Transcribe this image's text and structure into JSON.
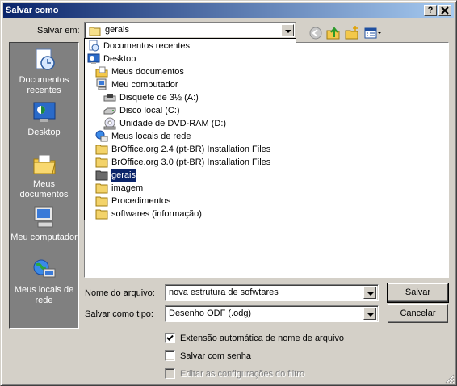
{
  "window": {
    "title": "Salvar como",
    "help_button": "?",
    "close_button": "✕"
  },
  "toolbar": {
    "save_in_label": "Salvar em:",
    "save_in_value": "gerais",
    "icons": [
      "back-icon",
      "up-folder-icon",
      "new-folder-icon",
      "view-menu-icon"
    ]
  },
  "places": [
    {
      "label": "Documentos recentes",
      "icon": "recent-documents-icon"
    },
    {
      "label": "Desktop",
      "icon": "desktop-icon"
    },
    {
      "label": "Meus documentos",
      "icon": "my-documents-icon"
    },
    {
      "label": "Meu computador",
      "icon": "my-computer-icon"
    },
    {
      "label": "Meus locais de rede",
      "icon": "network-places-icon"
    }
  ],
  "dropdown": {
    "items": [
      {
        "label": "Documentos recentes",
        "icon": "recent-documents-icon"
      },
      {
        "label": "Desktop",
        "icon": "desktop-icon"
      },
      {
        "label": "Meus documentos",
        "icon": "my-documents-icon"
      },
      {
        "label": "Meu computador",
        "icon": "my-computer-icon"
      },
      {
        "label": "Disquete de 3½ (A:)",
        "icon": "floppy-drive-icon"
      },
      {
        "label": "Disco local (C:)",
        "icon": "hard-drive-icon"
      },
      {
        "label": "Unidade de DVD-RAM (D:)",
        "icon": "dvd-drive-icon"
      },
      {
        "label": "Meus locais de rede",
        "icon": "network-places-icon"
      },
      {
        "label": "BrOffice.org 2.4 (pt-BR) Installation Files",
        "icon": "folder-icon"
      },
      {
        "label": "BrOffice.org 3.0 (pt-BR) Installation Files",
        "icon": "folder-icon"
      },
      {
        "label": "gerais",
        "icon": "open-folder-icon",
        "selected": true
      },
      {
        "label": "imagem",
        "icon": "folder-icon"
      },
      {
        "label": "Procedimentos",
        "icon": "folder-icon"
      },
      {
        "label": "softwares (informação)",
        "icon": "folder-icon"
      }
    ]
  },
  "form": {
    "filename_label": "Nome do arquivo:",
    "filename_value": "nova estrutura de sofwtares",
    "filetype_label": "Salvar como tipo:",
    "filetype_value": "Desenho ODF (.odg)",
    "save_button": "Salvar",
    "cancel_button": "Cancelar"
  },
  "options": {
    "auto_extension": {
      "label": "Extensão automática de nome de arquivo",
      "checked": true
    },
    "save_with_password": {
      "label": "Salvar com senha",
      "checked": false
    },
    "edit_filter_settings": {
      "label": "Editar as configurações do filtro",
      "checked": false,
      "disabled": true
    }
  },
  "colors": {
    "title_start": "#0a246a",
    "title_end": "#a6caf0",
    "selection": "#0a246a",
    "face": "#d4d0c8"
  }
}
